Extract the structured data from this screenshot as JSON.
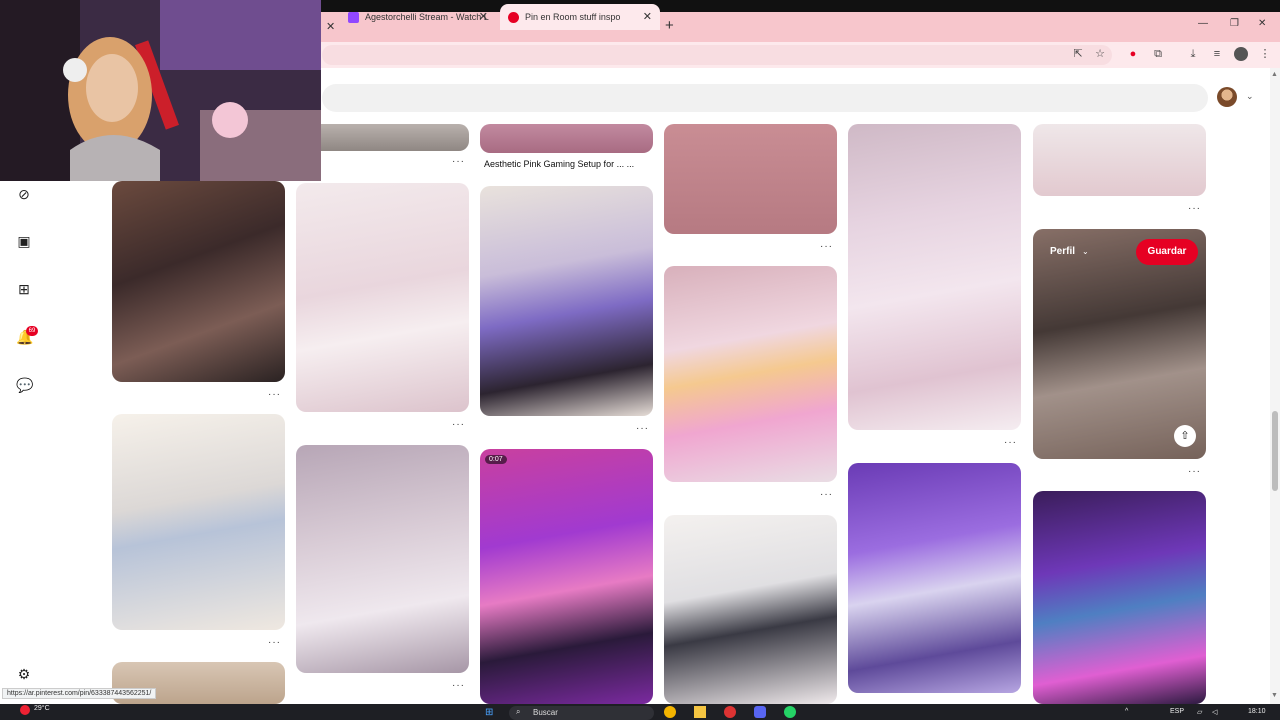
{
  "browser": {
    "tabs": [
      {
        "label": "Agestorchelli Stream - Watch L"
      },
      {
        "label": "Pin en Room stuff inspo",
        "active": true
      }
    ],
    "new_tab": "+",
    "status_url": "https://ar.pinterest.com/pin/633387443562251/"
  },
  "pin_grid": {
    "caption_2": "Aesthetic Pink Gaming Setup for ... ...",
    "video_time": "0:07",
    "dots": "···"
  },
  "hover_pin": {
    "profile_label": "Perfil",
    "save_label": "Guardar"
  },
  "notifications": {
    "count": "69"
  },
  "taskbar": {
    "weather_temp": "29°C",
    "search_label": "Buscar",
    "lang": "ESP",
    "time": "18:10"
  },
  "colors": {
    "pinterest_red": "#e60023",
    "tabbar_pink": "#f7c6cc"
  }
}
